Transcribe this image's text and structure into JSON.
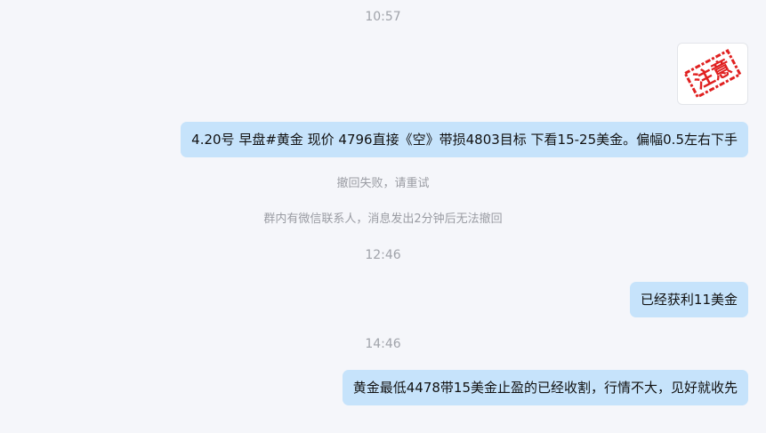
{
  "chat": {
    "time_1": "10:57",
    "image_message": {
      "stamp_text": "注意",
      "stamp_color": "#e02020"
    },
    "message_1": "4.20号 早盘#黄金 现价 4796直接《空》带损4803目标    下看15-25美金。偏幅0.5左右下手",
    "system_1": "撤回失败，请重试",
    "system_2": "群内有微信联系人，消息发出2分钟后无法撤回",
    "time_2": "12:46",
    "message_2": "已经获利11美金",
    "time_3": "14:46",
    "message_3": "黄金最低4478带15美金止盈的已经收割，行情不大，见好就收先"
  },
  "colors": {
    "background": "#f5f6fa",
    "bubble": "#c6e3fb",
    "timestamp_text": "#a0a3aa"
  }
}
